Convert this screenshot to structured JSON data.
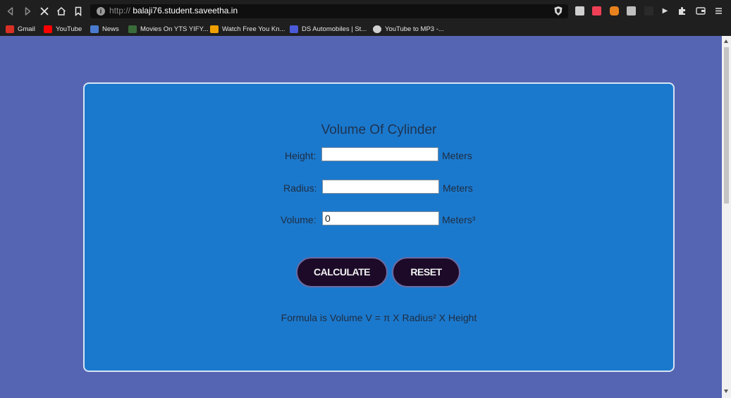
{
  "browser": {
    "url_scheme": "http://",
    "url_host": "balaji76.student.saveetha.in",
    "url_info_symbol": "i",
    "nav_icons": [
      "back-icon",
      "forward-icon",
      "stop-icon",
      "home-icon",
      "bookmark-icon"
    ],
    "extension_icons": [
      "brave-shield-icon",
      "k-extension-icon",
      "pocket-icon",
      "metamask-icon",
      "image-extension-icon",
      "rewards-icon",
      "play-icon",
      "puzzle-icon",
      "wallet-icon",
      "menu-icon"
    ],
    "bookmarks": [
      {
        "label": "Gmail",
        "icon": "gmail-icon",
        "color": "#d93025"
      },
      {
        "label": "YouTube",
        "icon": "youtube-icon",
        "color": "#ff0000"
      },
      {
        "label": "News",
        "icon": "news-icon",
        "color": "#4a7bd0"
      },
      {
        "label": "Movies On YTS YIFY...",
        "icon": "yts-icon",
        "color": "#3a6b3a"
      },
      {
        "label": "Watch Free You Kn...",
        "icon": "hd-icon",
        "color": "#f0a000"
      },
      {
        "label": "DS Automobiles | St...",
        "icon": "ds-icon",
        "color": "#4a5ad8"
      },
      {
        "label": "YouTube to MP3 -...",
        "icon": "globe-icon",
        "color": "#d0d0d0"
      }
    ]
  },
  "app": {
    "title": "Volume Of Cylinder",
    "height": {
      "label": "Height:",
      "value": "",
      "unit": "Meters"
    },
    "radius": {
      "label": "Radius:",
      "value": "",
      "unit": "Meters"
    },
    "volume": {
      "label": "Volume:",
      "value": "0",
      "unit": "Meters³"
    },
    "calculate_label": "CALCULATE",
    "reset_label": "RESET",
    "formula": "Formula is Volume V = π X Radius² X Height"
  },
  "colors": {
    "page_background": "#5565b3",
    "card_background": "#1b79cd",
    "button_background": "#1c0a28"
  }
}
